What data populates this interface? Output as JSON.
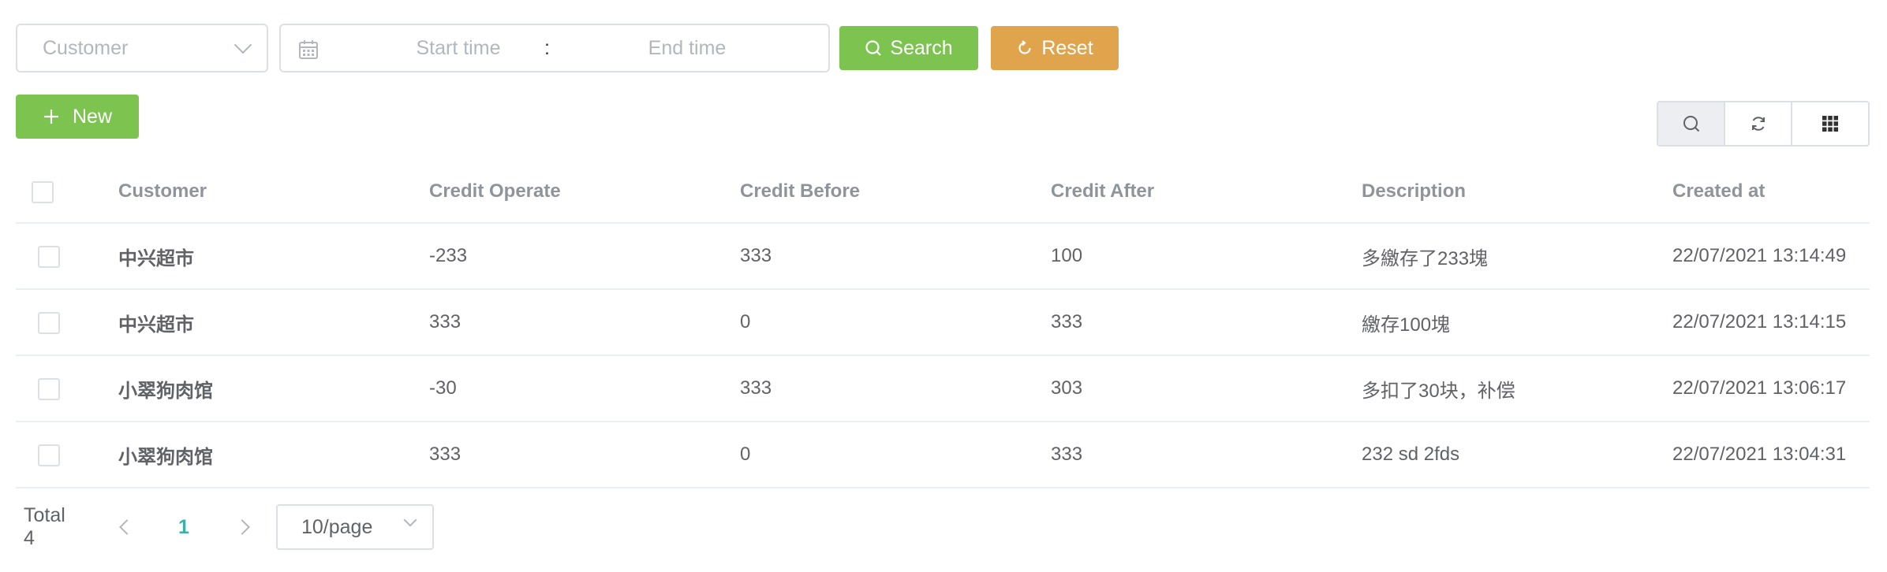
{
  "filters": {
    "customer_placeholder": "Customer",
    "start_placeholder": "Start time",
    "range_separator": ":",
    "end_placeholder": "End time",
    "search_label": "Search",
    "reset_label": "Reset"
  },
  "actions": {
    "new_label": "New"
  },
  "toolbar_icons": [
    "search-icon",
    "refresh-icon",
    "grid-columns-icon"
  ],
  "table": {
    "columns": [
      "Customer",
      "Credit Operate",
      "Credit Before",
      "Credit After",
      "Description",
      "Created at"
    ],
    "rows": [
      {
        "customer": "中兴超市",
        "operate": "-233",
        "before": "333",
        "after": "100",
        "description": "多繳存了233塊",
        "created_at": "22/07/2021 13:14:49"
      },
      {
        "customer": "中兴超市",
        "operate": "333",
        "before": "0",
        "after": "333",
        "description": "繳存100塊",
        "created_at": "22/07/2021 13:14:15"
      },
      {
        "customer": "小翠狗肉馆",
        "operate": "-30",
        "before": "333",
        "after": "303",
        "description": "多扣了30块，补偿",
        "created_at": "22/07/2021 13:06:17"
      },
      {
        "customer": "小翠狗肉馆",
        "operate": "333",
        "before": "0",
        "after": "333",
        "description": "232 sd 2fds",
        "created_at": "22/07/2021 13:04:31"
      }
    ]
  },
  "pagination": {
    "total_label": "Total 4",
    "current_page": "1",
    "page_size": "10/page"
  },
  "colors": {
    "primary_green": "#7cc350",
    "warning_orange": "#e0a54c",
    "active_page": "#3eaea8"
  }
}
